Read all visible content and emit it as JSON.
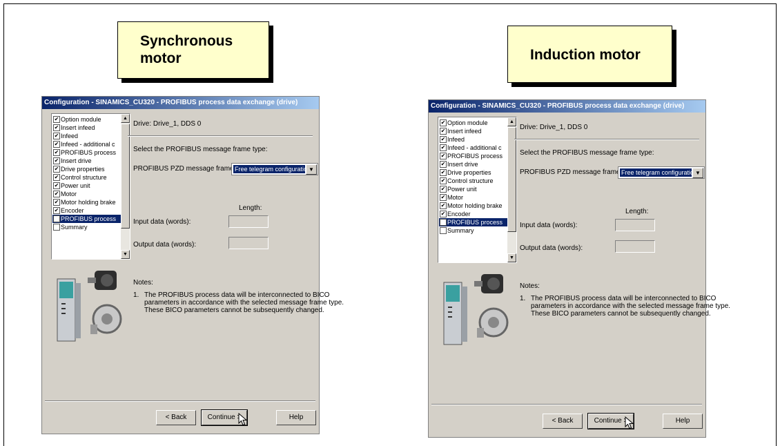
{
  "callouts": {
    "left": {
      "line1": "Synchronous",
      "line2": "motor"
    },
    "right": {
      "line1": "Induction motor"
    }
  },
  "dialog": {
    "title": "Configuration - SINAMICS_CU320 - PROFIBUS process data exchange (drive)",
    "nav_items": [
      {
        "label": "Option module",
        "checked": true
      },
      {
        "label": "Insert infeed",
        "checked": true
      },
      {
        "label": "Infeed",
        "checked": true
      },
      {
        "label": "Infeed - additional c",
        "checked": true
      },
      {
        "label": "PROFIBUS process",
        "checked": true
      },
      {
        "label": "Insert drive",
        "checked": true
      },
      {
        "label": "Drive properties",
        "checked": true
      },
      {
        "label": "Control structure",
        "checked": true
      },
      {
        "label": "Power unit",
        "checked": true
      },
      {
        "label": "Motor",
        "checked": true
      },
      {
        "label": "Motor holding brake",
        "checked": true
      },
      {
        "label": "Encoder",
        "checked": true
      },
      {
        "label": "PROFIBUS process",
        "checked": false,
        "selected": true
      },
      {
        "label": "Summary",
        "checked": false
      }
    ],
    "drive_label": "Drive: Drive_1, DDS 0",
    "select_prompt": "Select the PROFIBUS message frame type:",
    "pzd_label": "PROFIBUS PZD message frame:",
    "pzd_value": "Free telegram configuration with BICO",
    "length_header": "Length:",
    "input_label": "Input data (words):",
    "output_label": "Output data (words):",
    "notes_heading": "Notes:",
    "note_number": "1.",
    "note_lines": [
      "The PROFIBUS process data will be interconnected to BICO",
      "parameters in accordance with the selected message frame type.",
      "These BICO parameters cannot be subsequently changed."
    ],
    "back_button": "< Back",
    "continue_button": "Continue >",
    "help_button": "Help"
  },
  "colors": {
    "callout_bg": "#ffffcc",
    "titlebar_start": "#0a246a",
    "titlebar_end": "#a6caf0",
    "dialog_bg": "#d4d0c8",
    "selection": "#0a246a"
  },
  "icons": [
    "checkbox-checked-icon",
    "scroll-up-arrow-icon",
    "scroll-down-arrow-icon",
    "dropdown-arrow-icon",
    "mouse-pointer-icon",
    "drive-hardware-image"
  ]
}
